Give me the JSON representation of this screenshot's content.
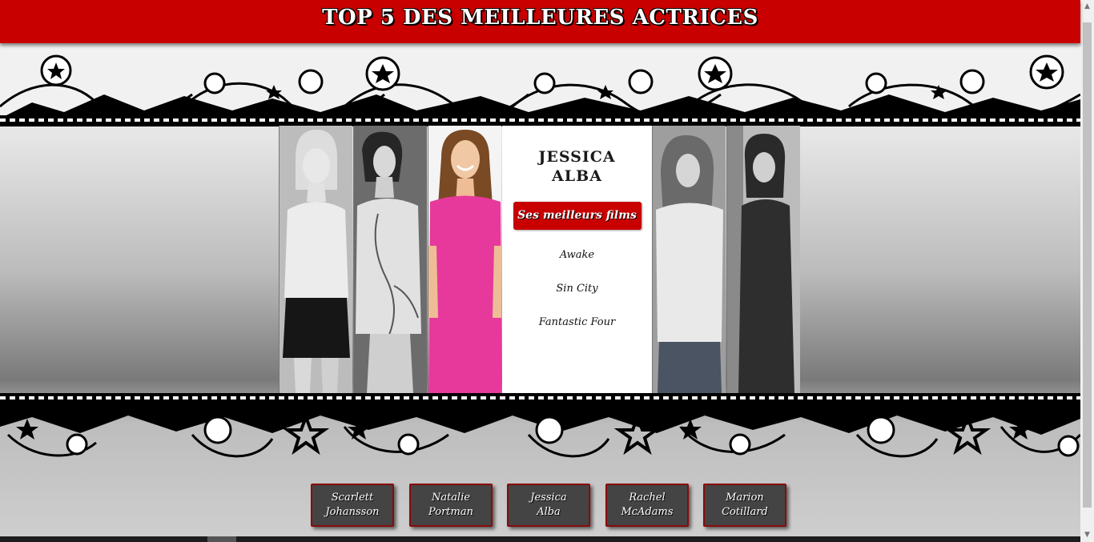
{
  "header": {
    "title": "TOP 5 DES MEILLEURES ACTRICES"
  },
  "gallery": {
    "photos": [
      {
        "actress": "Scarlett Johansson",
        "tone": "grayscale"
      },
      {
        "actress": "Natalie Portman",
        "tone": "grayscale"
      },
      {
        "actress": "Jessica Alba",
        "tone": "color"
      },
      {
        "actress": "Rachel McAdams",
        "tone": "grayscale"
      },
      {
        "actress": "Marion Cotillard",
        "tone": "grayscale"
      }
    ]
  },
  "selected": {
    "first_name": "JESSICA",
    "last_name": "ALBA",
    "films_button": "Ses meilleurs films",
    "films": [
      "Awake",
      "Sin City",
      "Fantastic Four"
    ]
  },
  "nav": {
    "buttons": [
      {
        "line1": "Scarlett",
        "line2": "Johansson"
      },
      {
        "line1": "Natalie",
        "line2": "Portman"
      },
      {
        "line1": "Jessica",
        "line2": "Alba"
      },
      {
        "line1": "Rachel",
        "line2": "McAdams"
      },
      {
        "line1": "Marion",
        "line2": "Cotillard"
      }
    ]
  },
  "colors": {
    "brand_red": "#c80000",
    "button_dark": "#444444",
    "dress_pink": "#e6399b"
  }
}
